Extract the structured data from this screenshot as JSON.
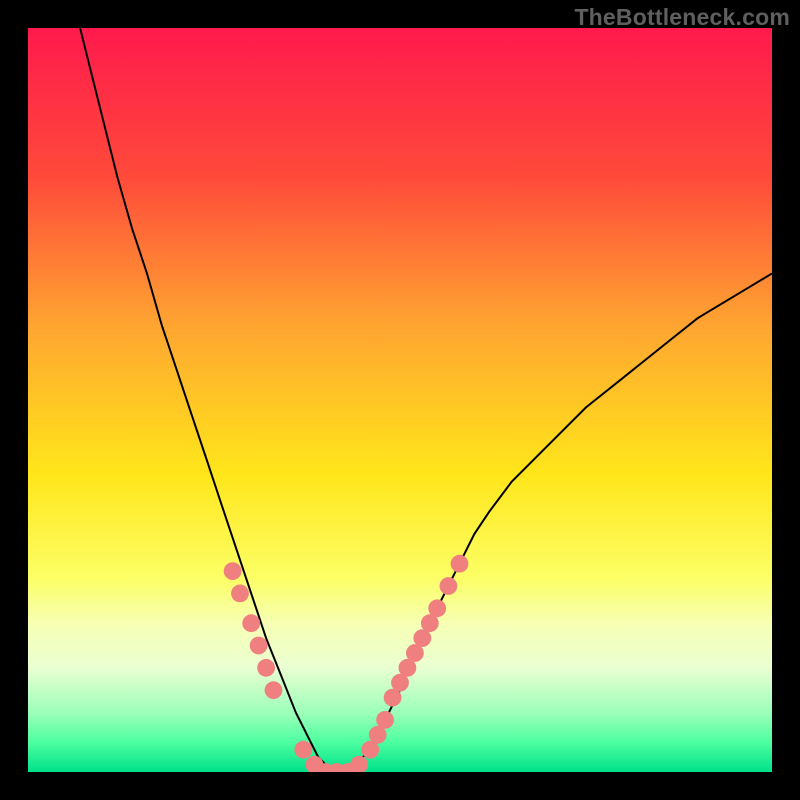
{
  "attribution": "TheBottleneck.com",
  "chart_data": {
    "type": "line",
    "title": "",
    "xlabel": "",
    "ylabel": "",
    "xlim": [
      0,
      100
    ],
    "ylim": [
      0,
      100
    ],
    "grid": false,
    "legend": false,
    "background_gradient_stops": [
      {
        "offset": 0.0,
        "color": "#ff1a4d"
      },
      {
        "offset": 0.2,
        "color": "#ff4a3a"
      },
      {
        "offset": 0.4,
        "color": "#ffa531"
      },
      {
        "offset": 0.6,
        "color": "#ffe61a"
      },
      {
        "offset": 0.74,
        "color": "#fcff66"
      },
      {
        "offset": 0.8,
        "color": "#f6ffb3"
      },
      {
        "offset": 0.86,
        "color": "#eaffd1"
      },
      {
        "offset": 0.92,
        "color": "#9cffba"
      },
      {
        "offset": 0.96,
        "color": "#4dffa0"
      },
      {
        "offset": 1.0,
        "color": "#00e08a"
      }
    ],
    "series": [
      {
        "name": "bottleneck-curve",
        "color": "#000000",
        "x": [
          7,
          8,
          10,
          12,
          14,
          16,
          18,
          20,
          22,
          24,
          26,
          28,
          30,
          32,
          34,
          36,
          38,
          39,
          40,
          41,
          42,
          43,
          44,
          46,
          48,
          50,
          52,
          54,
          56,
          58,
          60,
          62,
          65,
          70,
          75,
          80,
          85,
          90,
          95,
          100
        ],
        "y": [
          100,
          96,
          88,
          80,
          73,
          67,
          60,
          54,
          48,
          42,
          36,
          30,
          24,
          18,
          13,
          8,
          4,
          2,
          1,
          0,
          0,
          0,
          1,
          3,
          7,
          11,
          16,
          20,
          24,
          28,
          32,
          35,
          39,
          44,
          49,
          53,
          57,
          61,
          64,
          67
        ]
      }
    ],
    "highlight_markers": {
      "name": "marker-dots",
      "color": "#f08080",
      "radius_pct": 1.2,
      "points": [
        {
          "x": 27.5,
          "y": 27
        },
        {
          "x": 28.5,
          "y": 24
        },
        {
          "x": 30.0,
          "y": 20
        },
        {
          "x": 31.0,
          "y": 17
        },
        {
          "x": 32.0,
          "y": 14
        },
        {
          "x": 33.0,
          "y": 11
        },
        {
          "x": 37.0,
          "y": 3
        },
        {
          "x": 38.5,
          "y": 1
        },
        {
          "x": 40.0,
          "y": 0
        },
        {
          "x": 41.5,
          "y": 0
        },
        {
          "x": 43.0,
          "y": 0
        },
        {
          "x": 44.5,
          "y": 1
        },
        {
          "x": 46.0,
          "y": 3
        },
        {
          "x": 47.0,
          "y": 5
        },
        {
          "x": 48.0,
          "y": 7
        },
        {
          "x": 49.0,
          "y": 10
        },
        {
          "x": 50.0,
          "y": 12
        },
        {
          "x": 51.0,
          "y": 14
        },
        {
          "x": 52.0,
          "y": 16
        },
        {
          "x": 53.0,
          "y": 18
        },
        {
          "x": 54.0,
          "y": 20
        },
        {
          "x": 55.0,
          "y": 22
        },
        {
          "x": 56.5,
          "y": 25
        },
        {
          "x": 58.0,
          "y": 28
        }
      ]
    }
  }
}
